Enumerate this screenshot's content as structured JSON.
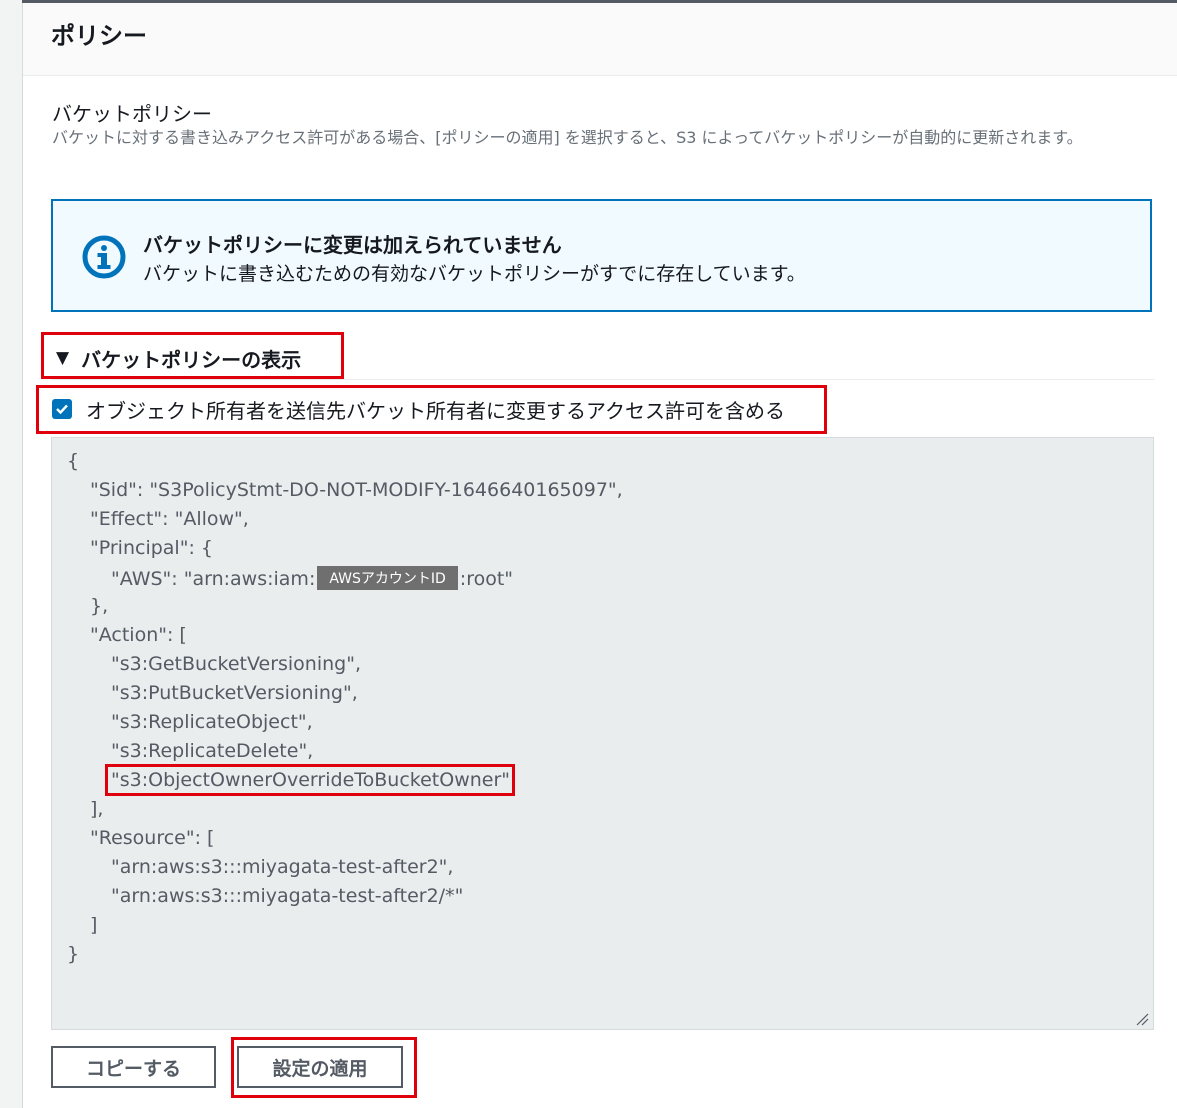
{
  "header": {
    "title": "ポリシー"
  },
  "bucket_policy": {
    "title": "バケットポリシー",
    "description": "バケットに対する書き込みアクセス許可がある場合、[ポリシーの適用] を選択すると、S3 によってバケットポリシーが自動的に更新されます。"
  },
  "info_alert": {
    "icon": "info-icon",
    "title": "バケットポリシーに変更は加えられていません",
    "body": "バケットに書き込むための有効なバケットポリシーがすでに存在しています。"
  },
  "expander": {
    "label": "バケットポリシーの表示",
    "expanded": true
  },
  "option": {
    "label": "オブジェクト所有者を送信先バケット所有者に変更するアクセス許可を含める",
    "checked": true
  },
  "policy_code": {
    "open_brace": "{",
    "sid": "\"Sid\": \"S3PolicyStmt-DO-NOT-MODIFY-1646640165097\",",
    "effect": "\"Effect\": \"Allow\",",
    "principal_open": "\"Principal\": {",
    "aws_prefix": "\"AWS\": \"arn:aws:iam:",
    "account_redaction": "AWSアカウントID",
    "aws_suffix": ":root\"",
    "principal_close": "},",
    "action_open": "\"Action\": [",
    "actions": [
      "\"s3:GetBucketVersioning\",",
      "\"s3:PutBucketVersioning\",",
      "\"s3:ReplicateObject\",",
      "\"s3:ReplicateDelete\",",
      "\"s3:ObjectOwnerOverrideToBucketOwner\""
    ],
    "action_close": "],",
    "resource_open": "\"Resource\": [",
    "resources": [
      "\"arn:aws:s3:::miyagata-test-after2\",",
      "\"arn:aws:s3:::miyagata-test-after2/*\""
    ],
    "resource_close": "]",
    "close_brace": "}"
  },
  "buttons": {
    "copy": "コピーする",
    "apply": "設定の適用"
  },
  "colors": {
    "accent": "#0073bb",
    "highlight": "#e0000b",
    "info_bg": "#f1faff",
    "code_bg": "#eaeded"
  }
}
